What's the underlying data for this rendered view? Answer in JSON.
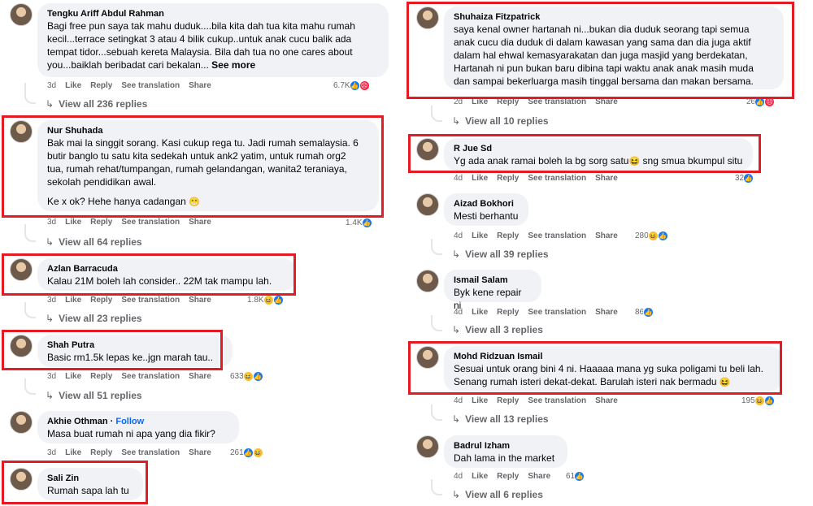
{
  "left_column": [
    {
      "author": "Tengku Ariff Abdul Rahman",
      "lines": [
        "Bagi free pun saya tak mahu duduk....bila kita dah tua kita mahu rumah",
        "kecil...terrace setingkat 3 atau 4 bilik cukup..untuk anak cucu balik ada",
        "tempat tidor...sebuah kereta Malaysia. Bila dah tua no one cares about",
        "you...baiklah beribadat cari bekalan..."
      ],
      "see_more": "See more",
      "time": "3d",
      "reaction_count": "6.7K",
      "replies": "View all 236 replies"
    },
    {
      "author": "Nur Shuhada",
      "lines": [
        "Bak mai la singgit sorang. Kasi cukup rega tu. Jadi rumah semalaysia. 6",
        "butir banglo tu satu kita sedekah untuk ank2 yatim, untuk rumah org2",
        "tua, rumah rehat/tumpangan, rumah gelandangan, wanita2 teraniaya,",
        "sekolah pendidikan awal."
      ],
      "extra_line": "Ke x ok? Hehe hanya cadangan",
      "time": "3d",
      "reaction_count": "1.4K",
      "replies": "View all 64 replies"
    },
    {
      "author": "Azlan Barracuda",
      "lines": [
        "Kalau 21M boleh lah consider.. 22M tak mampu lah."
      ],
      "time": "3d",
      "reaction_count": "1.8K",
      "replies": "View all 23 replies"
    },
    {
      "author": "Shah Putra",
      "lines": [
        "Basic rm1.5k lepas ke..jgn marah tau.."
      ],
      "time": "3d",
      "reaction_count": "633",
      "replies": "View all 51 replies"
    },
    {
      "author": "Akhie Othman",
      "follow": "Follow",
      "lines": [
        "Masa buat rumah ni apa yang dia fikir?"
      ],
      "time": "3d",
      "reaction_count": "261"
    },
    {
      "author": "Sali Zin",
      "lines": [
        "Rumah sapa lah tu"
      ]
    }
  ],
  "right_column": [
    {
      "author": "Shuhaiza Fitzpatrick",
      "lines": [
        "saya kenal owner hartanah ni...bukan dia duduk seorang tapi semua",
        "anak cucu dia duduk di dalam kawasan yang sama dan dia juga aktif",
        "dalam hal ehwal kemasyarakatan dan juga masjid yang berdekatan,",
        "Hartanah ni pun bukan baru dibina tapi waktu anak anak masih muda",
        "dan sampai bekerluarga masih tinggal bersama dan makan bersama."
      ],
      "time": "2d",
      "reaction_count": "26",
      "replies": "View all 10 replies"
    },
    {
      "author": "R Jue Sd",
      "lines": [
        "Yg ada anak ramai boleh la bg sorg satu"
      ],
      "line_suffix": "sng smua bkumpul situ",
      "time": "4d",
      "reaction_count": "32"
    },
    {
      "author": "Aizad Bokhori",
      "lines": [
        "Mesti berhantu"
      ],
      "time": "4d",
      "reaction_count": "280",
      "replies": "View all 39 replies"
    },
    {
      "author": "Ismail Salam",
      "lines": [
        "Byk kene repair ni"
      ],
      "time": "4d",
      "reaction_count": "86",
      "replies": "View all 3 replies"
    },
    {
      "author": "Mohd Ridzuan Ismail",
      "lines": [
        "Sesuai untuk orang bini 4 ni. Haaaaa mana yg suka poligami tu beli lah.",
        "Senang rumah isteri dekat-dekat. Barulah isteri nak bermadu"
      ],
      "time": "4d",
      "reaction_count": "195",
      "replies": "View all 13 replies"
    },
    {
      "author": "Badrul Izham",
      "lines": [
        "Dah lama in the market"
      ],
      "time": "4d",
      "reaction_count": "61",
      "replies": "View all 6 replies"
    }
  ],
  "labels": {
    "like": "Like",
    "reply": "Reply",
    "see_translation": "See translation",
    "share": "Share"
  },
  "emojis": {
    "grin": "😁",
    "laugh": "😆",
    "haha": "😆"
  },
  "colors": {
    "highlight": "#e41b23",
    "bubble": "#f0f2f5",
    "link_blue": "#0866ff"
  }
}
